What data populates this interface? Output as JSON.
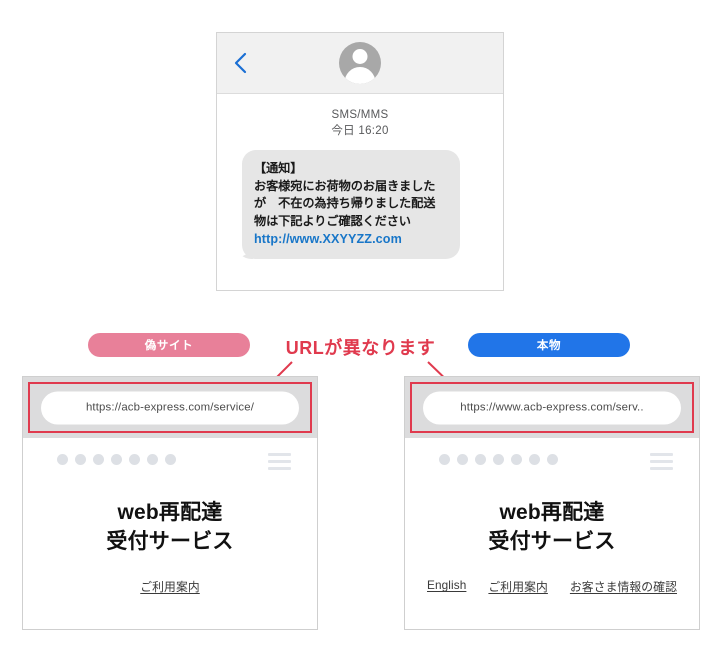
{
  "sms": {
    "back_icon": "back-chevron-icon",
    "avatar_icon": "person-avatar-icon",
    "channel": "SMS/MMS",
    "timestamp": "今日 16:20",
    "message_lines": [
      "【通知】",
      "お客様宛にお荷物のお届きました",
      "が　不在の為持ち帰りました配送",
      "物は下記よりご確認ください"
    ],
    "message_link": "http://www.XXYYZZ.com"
  },
  "annotation": {
    "text": "URLが異なります",
    "color": "#e03a4e"
  },
  "badges": {
    "fake": {
      "label": "偽サイト",
      "color": "#e88099"
    },
    "real": {
      "label": "本物",
      "color": "#2175e8"
    }
  },
  "phones": [
    {
      "side": "left",
      "kind": "fake",
      "url": "https://acb-express.com/service/",
      "title_lines": [
        "web再配達",
        "受付サービス"
      ],
      "links": [
        "ご利用案内"
      ],
      "dots_count": 7,
      "menu_icon": "hamburger-menu-icon"
    },
    {
      "side": "right",
      "kind": "real",
      "url": "https://www.acb-express.com/serv..",
      "title_lines": [
        "web再配達",
        "受付サービス"
      ],
      "links": [
        "English",
        "ご利用案内",
        "お客さま情報の確認"
      ],
      "dots_count": 7,
      "menu_icon": "hamburger-menu-icon"
    }
  ]
}
